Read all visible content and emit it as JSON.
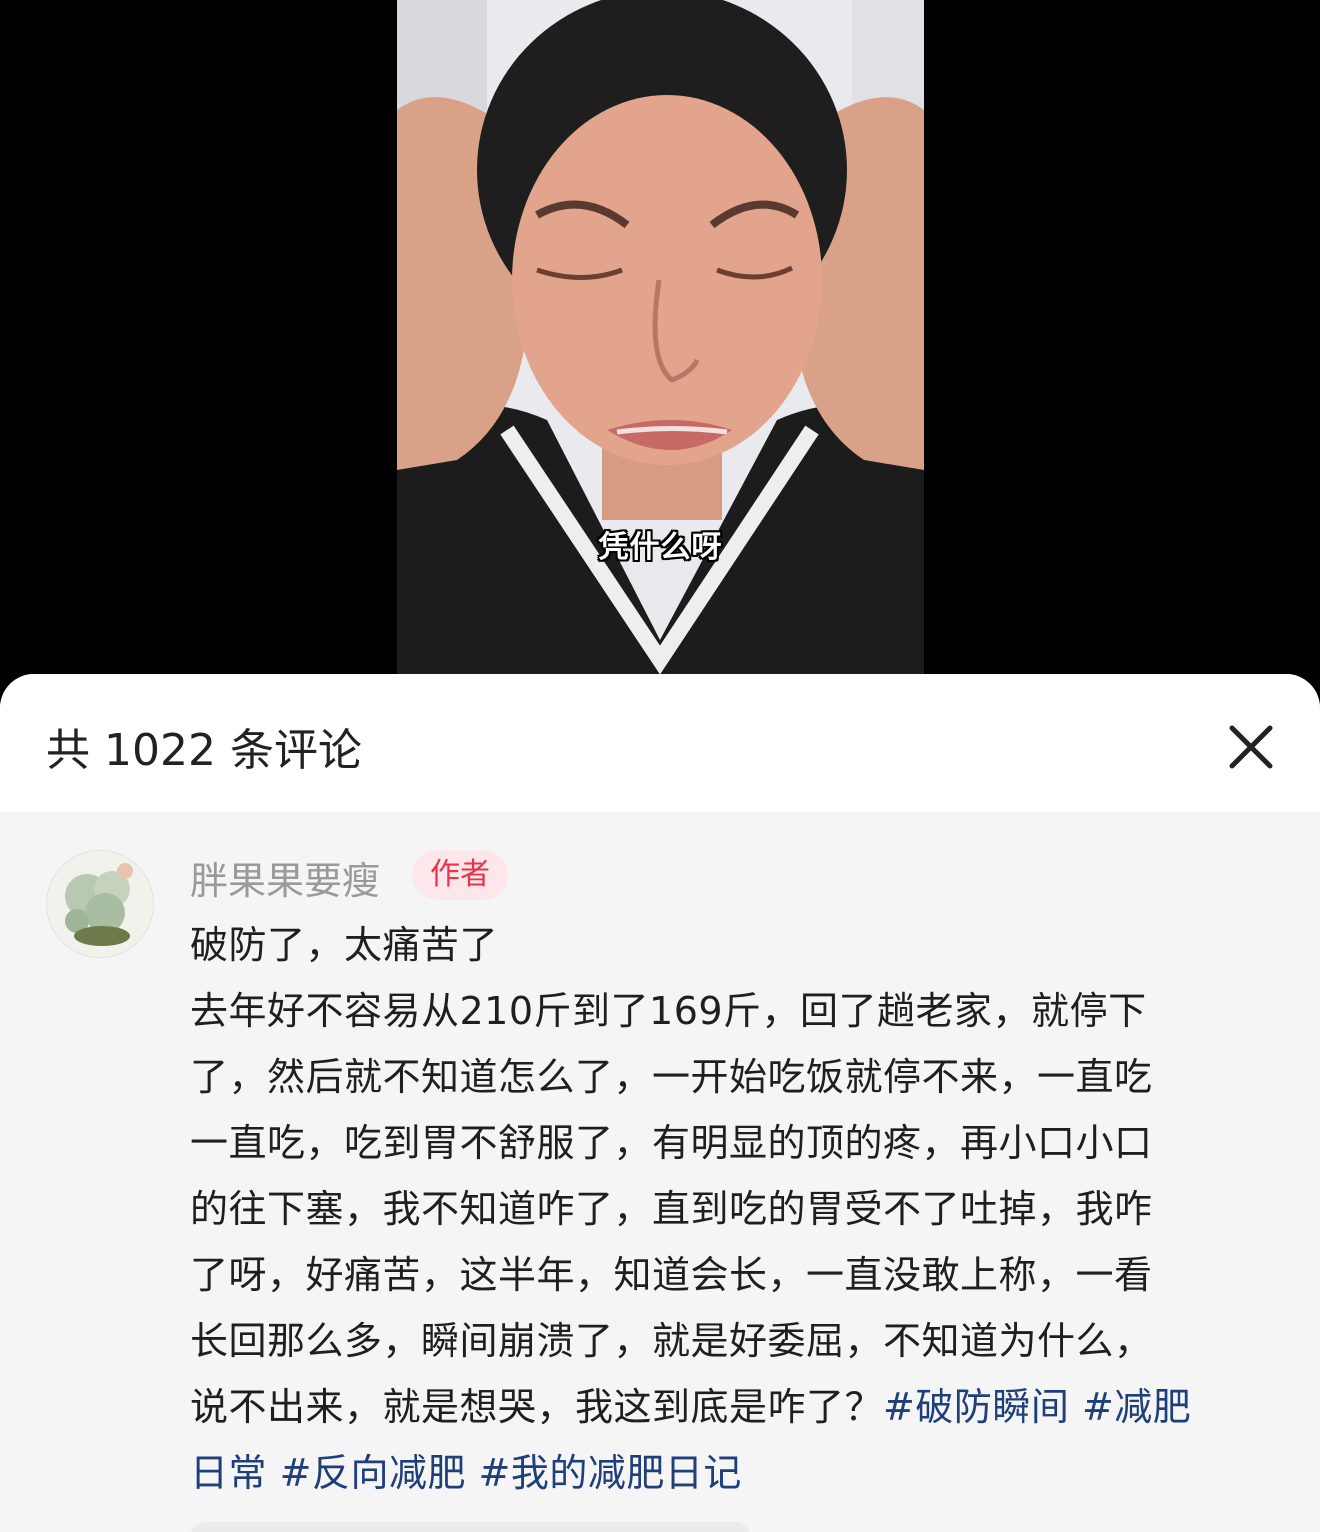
{
  "video": {
    "subtitle": "凭什么呀"
  },
  "comments_panel": {
    "title": "共 1022 条评论",
    "close_icon": "close-icon"
  },
  "comment": {
    "username": "胖果果要瘦",
    "badge": "作者",
    "lines": [
      "破防了，太痛苦了",
      "去年好不容易从210斤到了169斤，回了趟老家，就停下",
      "了，然后就不知道怎么了，一开始吃饭就停不来，一直吃",
      "一直吃，吃到胃不舒服了，有明显的顶的疼，再小口小口",
      "的往下塞，我不知道咋了，直到吃的胃受不了吐掉，我咋",
      "了呀，好痛苦，这半年，知道会长，一直没敢上称，一看",
      "长回那么多，瞬间崩溃了，就是好委屈，不知道为什么，",
      "说不出来，就是想哭，我这到底是咋了？"
    ],
    "hashtags": [
      "#破防瞬间",
      "#减肥",
      "日常",
      "#反向减肥",
      "#我的减肥日记"
    ]
  },
  "colors": {
    "badge_text": "#e8334a",
    "badge_bg": "#fde7ea",
    "hashtag": "#1f3f7a",
    "username": "#9a9a9a"
  }
}
